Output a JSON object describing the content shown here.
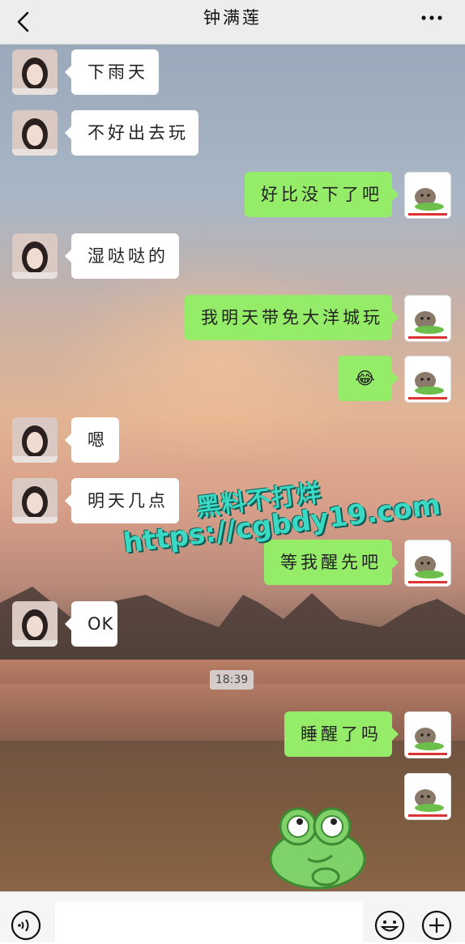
{
  "header": {
    "title": "钟满莲"
  },
  "messages": [
    {
      "side": "left",
      "text": "下雨天"
    },
    {
      "side": "left",
      "text": "不好出去玩"
    },
    {
      "side": "right",
      "text": "好比没下了吧"
    },
    {
      "side": "left",
      "text": "湿哒哒的"
    },
    {
      "side": "right",
      "text": "我明天带免大洋城玩"
    },
    {
      "side": "right",
      "text": "😂"
    },
    {
      "side": "left",
      "text": "嗯"
    },
    {
      "side": "left",
      "text": "明天几点"
    },
    {
      "side": "right",
      "text": "等我醒先吧"
    },
    {
      "side": "left",
      "text": "OK"
    },
    {
      "side": "right",
      "text": "睡醒了吗"
    }
  ],
  "timestamp": "18:39",
  "watermark": {
    "line1": "黑料不打烊",
    "line2": "https://cgbdy19.com"
  },
  "colors": {
    "bubble_self": "#95ec69",
    "bubble_other": "#ffffff",
    "header_bg": "#ededed"
  }
}
